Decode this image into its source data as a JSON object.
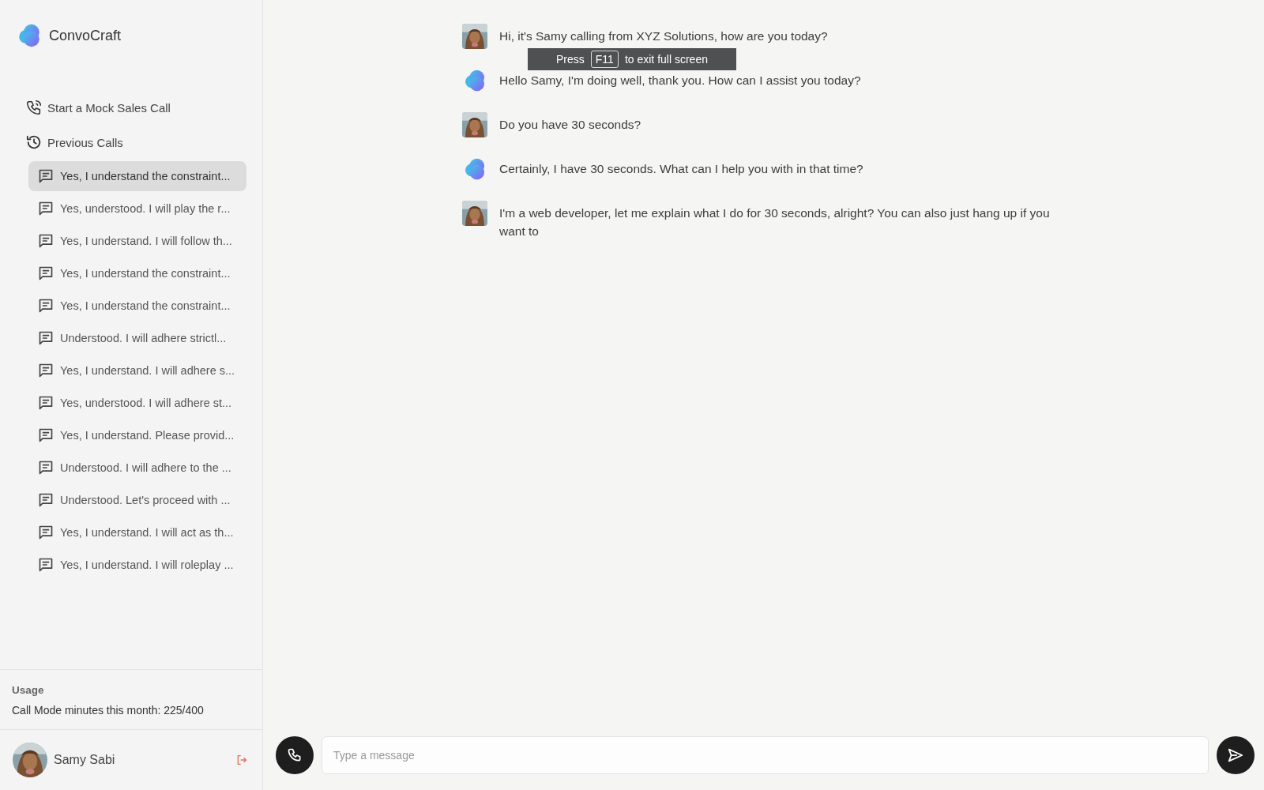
{
  "brand": {
    "name": "ConvoCraft"
  },
  "nav": [
    {
      "kind": "start",
      "label": "Start a Mock Sales Call"
    },
    {
      "kind": "history",
      "label": "Previous Calls"
    }
  ],
  "previous_calls": [
    {
      "label": "Yes, I understand the constraint...",
      "selected": true
    },
    {
      "label": "Yes, understood. I will play the r...",
      "selected": false
    },
    {
      "label": "Yes, I understand. I will follow th...",
      "selected": false
    },
    {
      "label": "Yes, I understand the constraint...",
      "selected": false
    },
    {
      "label": "Yes, I understand the constraint...",
      "selected": false
    },
    {
      "label": "Understood. I will adhere strictl...",
      "selected": false
    },
    {
      "label": "Yes, I understand. I will adhere s...",
      "selected": false
    },
    {
      "label": "Yes, understood. I will adhere st...",
      "selected": false
    },
    {
      "label": "Yes, I understand. Please provid...",
      "selected": false
    },
    {
      "label": "Understood. I will adhere to the ...",
      "selected": false
    },
    {
      "label": "Understood. Let's proceed with ...",
      "selected": false
    },
    {
      "label": "Yes, I understand. I will act as th...",
      "selected": false
    },
    {
      "label": "Yes, I understand. I will roleplay ...",
      "selected": false
    }
  ],
  "usage": {
    "title": "Usage",
    "text": "Call Mode minutes this month: 225/400"
  },
  "user": {
    "name": "Samy Sabi"
  },
  "messages": [
    {
      "kind": "user",
      "text": "Hi, it's Samy calling from XYZ Solutions, how are you today?"
    },
    {
      "kind": "bot",
      "text": "Hello Samy, I'm doing well, thank you. How can I assist you today?"
    },
    {
      "kind": "user",
      "text": "Do you have 30 seconds?"
    },
    {
      "kind": "bot",
      "text": "Certainly, I have 30 seconds. What can I help you with in that time?"
    },
    {
      "kind": "user",
      "text": "I'm a web developer, let me explain what I do for 30 seconds, alright? You can also just hang up if you want to"
    }
  ],
  "composer": {
    "placeholder": "Type a message"
  },
  "fullscreen_notice": {
    "before": "Press",
    "key": "F11",
    "after": "to exit full screen"
  }
}
